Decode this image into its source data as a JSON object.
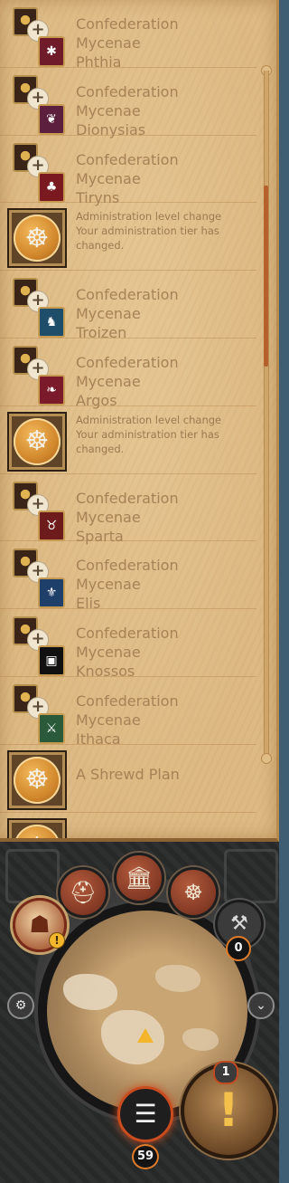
{
  "log": {
    "items": [
      {
        "type": "conf",
        "l1": "Confederation",
        "l2": "Mycenae",
        "l3": "Phthia",
        "crest_color": "#6f1b2a",
        "crest_icon": "ant-icon",
        "glyph": "✱"
      },
      {
        "type": "conf",
        "l1": "Confederation",
        "l2": "Mycenae",
        "l3": "Dionysias",
        "crest_color": "#5c1f3d",
        "crest_icon": "grapes-icon",
        "glyph": "❦"
      },
      {
        "type": "conf",
        "l1": "Confederation",
        "l2": "Mycenae",
        "l3": "Tiryns",
        "crest_color": "#7a1a20",
        "crest_icon": "tree-icon",
        "glyph": "♣"
      },
      {
        "type": "admin",
        "l1": "Administration level change",
        "l2": "Your administration tier has changed."
      },
      {
        "type": "conf",
        "l1": "Confederation",
        "l2": "Mycenae",
        "l3": "Troizen",
        "crest_color": "#1f4e6a",
        "crest_icon": "horse-icon",
        "glyph": "♞"
      },
      {
        "type": "conf",
        "l1": "Confederation",
        "l2": "Mycenae",
        "l3": "Argos",
        "crest_color": "#7a1a2a",
        "crest_icon": "beast-icon",
        "glyph": "❧"
      },
      {
        "type": "admin",
        "l1": "Administration level change",
        "l2": "Your administration tier has changed."
      },
      {
        "type": "conf",
        "l1": "Confederation",
        "l2": "Mycenae",
        "l3": "Sparta",
        "crest_color": "#6e1b1b",
        "crest_icon": "bull-icon",
        "glyph": "♉"
      },
      {
        "type": "conf",
        "l1": "Confederation",
        "l2": "Mycenae",
        "l3": "Elis",
        "crest_color": "#1d3f6a",
        "crest_icon": "wheat-icon",
        "glyph": "⚜"
      },
      {
        "type": "conf",
        "l1": "Confederation",
        "l2": "Mycenae",
        "l3": "Knossos",
        "crest_color": "#111111",
        "crest_icon": "labyrinth-icon",
        "glyph": "▣"
      },
      {
        "type": "conf",
        "l1": "Confederation",
        "l2": "Mycenae",
        "l3": "Ithaca",
        "crest_color": "#2a5a3a",
        "crest_icon": "oars-icon",
        "glyph": "⚔"
      },
      {
        "type": "plan",
        "l1": "A Shrewd Plan"
      }
    ]
  },
  "hud": {
    "tabs": [
      {
        "name": "hoplite-helmet-icon",
        "glyph": "⛑"
      },
      {
        "name": "temple-icon",
        "glyph": "🏛"
      },
      {
        "name": "triskelion-icon",
        "glyph": "☸"
      }
    ],
    "advisor_alert": "!",
    "tool_count": "0",
    "alert_count": "1",
    "alert_glyph": "!",
    "list_count": "59",
    "accent_color": "#c94c1f"
  }
}
